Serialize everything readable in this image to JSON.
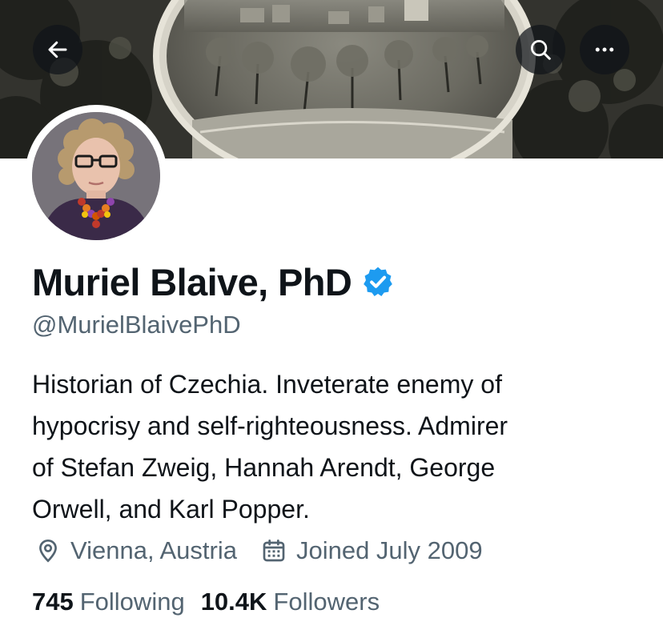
{
  "profile": {
    "display_name": "Muriel Blaive, PhD",
    "handle": "@MurielBlaivePhD",
    "verified": true,
    "bio_lines": [
      "Historian of Czechia. Inveterate enemy of",
      "hypocrisy and self-righteousness. Admirer",
      "of Stefan Zweig, Hannah Arendt, George",
      "Orwell, and Karl Popper."
    ],
    "location": "Vienna, Austria",
    "joined": "Joined July 2009"
  },
  "stats": {
    "following_count": "745",
    "following_label": "Following",
    "followers_count": "10.4K",
    "followers_label": "Followers"
  },
  "header_icons": {
    "back": "arrow-left-icon",
    "search": "search-icon",
    "more": "more-horizontal-icon"
  },
  "colors": {
    "text_primary": "#0f1419",
    "text_secondary": "#536471",
    "verified_blue": "#1d9bf0",
    "header_button_bg": "#0f1419"
  }
}
